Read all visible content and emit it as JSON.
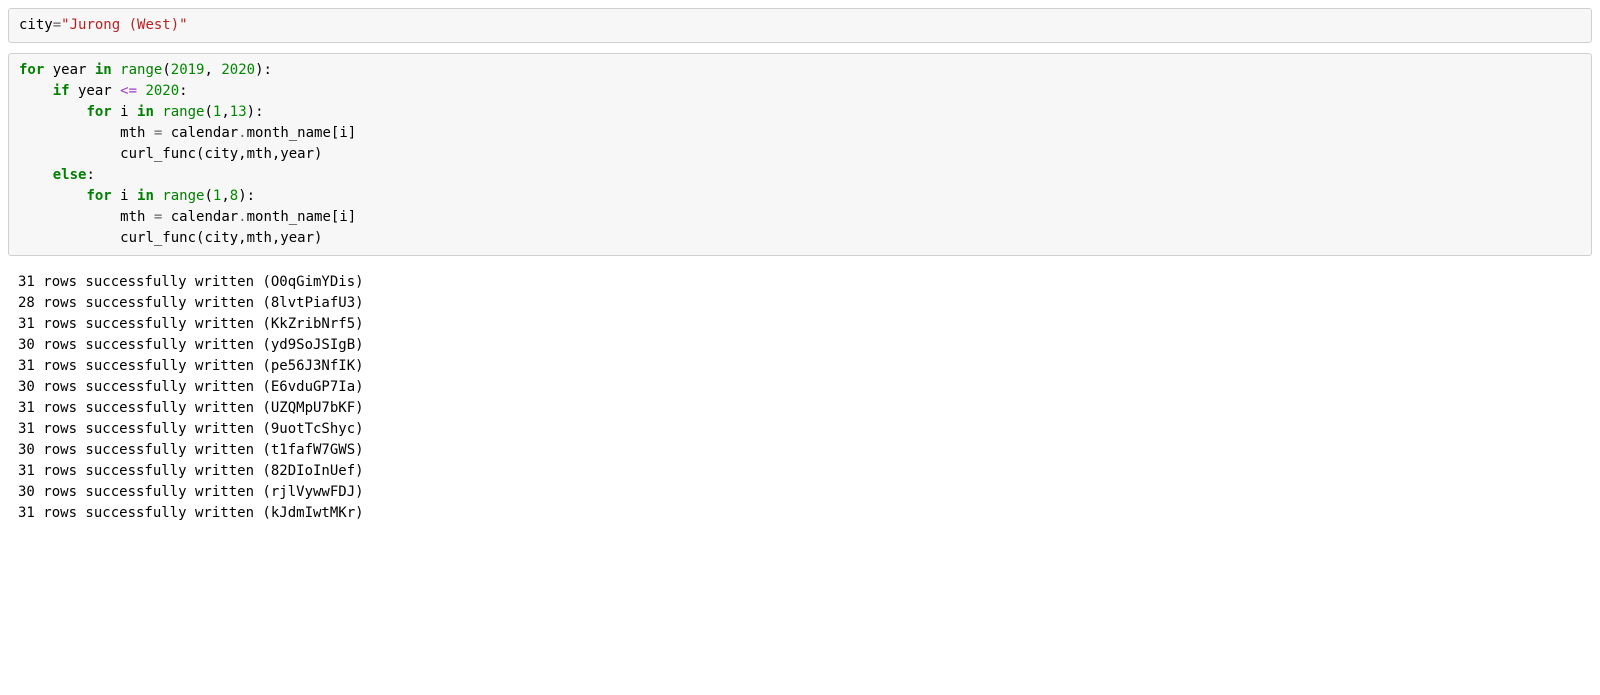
{
  "cell1": {
    "line1": {
      "s1": "city",
      "s2": "=",
      "s3": "\"Jurong (West)\""
    }
  },
  "cell2": {
    "l1": {
      "kw1": "for",
      "s1": " year ",
      "kw2": "in",
      "s2": " ",
      "fn": "range",
      "p1": "(",
      "n1": "2019",
      "c1": ", ",
      "n2": "2020",
      "p2": "):"
    },
    "l2": {
      "pad": "    ",
      "kw1": "if",
      "s1": " year ",
      "op": "<=",
      "s2": " ",
      "n1": "2020",
      "p1": ":"
    },
    "l3": {
      "pad": "        ",
      "kw1": "for",
      "s1": " i ",
      "kw2": "in",
      "s2": " ",
      "fn": "range",
      "p1": "(",
      "n1": "1",
      "c1": ",",
      "n2": "13",
      "p2": "):"
    },
    "l4": {
      "pad": "            ",
      "s1": "mth ",
      "op": "=",
      "s2": " calendar",
      "op2": ".",
      "s3": "month_name[i]"
    },
    "l5": {
      "pad": "            ",
      "s1": "curl_func(city,mth,year)"
    },
    "l6": {
      "pad": "    ",
      "kw1": "else",
      "p1": ":"
    },
    "l7": {
      "pad": "        ",
      "kw1": "for",
      "s1": " i ",
      "kw2": "in",
      "s2": " ",
      "fn": "range",
      "p1": "(",
      "n1": "1",
      "c1": ",",
      "n2": "8",
      "p2": "):"
    },
    "l8": {
      "pad": "            ",
      "s1": "mth ",
      "op": "=",
      "s2": " calendar",
      "op2": ".",
      "s3": "month_name[i]"
    },
    "l9": {
      "pad": "            ",
      "s1": "curl_func(city,mth,year)"
    }
  },
  "output": {
    "lines": [
      "31 rows successfully written (O0qGimYDis)",
      "28 rows successfully written (8lvtPiafU3)",
      "31 rows successfully written (KkZribNrf5)",
      "30 rows successfully written (yd9SoJSIgB)",
      "31 rows successfully written (pe56J3NfIK)",
      "30 rows successfully written (E6vduGP7Ia)",
      "31 rows successfully written (UZQMpU7bKF)",
      "31 rows successfully written (9uotTcShyc)",
      "30 rows successfully written (t1fafW7GWS)",
      "31 rows successfully written (82DIoInUef)",
      "30 rows successfully written (rjlVywwFDJ)",
      "31 rows successfully written (kJdmIwtMKr)"
    ]
  }
}
